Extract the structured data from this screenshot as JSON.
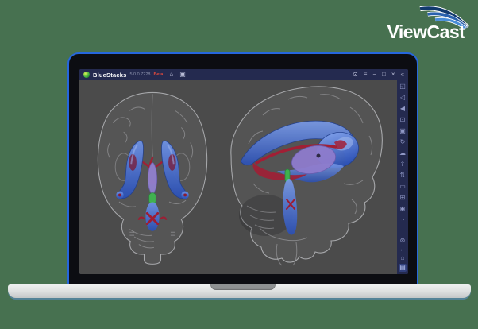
{
  "brand": {
    "name": "ViewCast",
    "registered": "®"
  },
  "emulator": {
    "titlebar": {
      "app_name": "BlueStacks",
      "version": "5.0.0.7228",
      "badge": "Beta",
      "left_icons": [
        {
          "name": "home-icon",
          "glyph": "⌂"
        },
        {
          "name": "screenshot-icon",
          "glyph": "▣"
        }
      ],
      "window_controls": [
        {
          "name": "info-icon",
          "glyph": "⊙"
        },
        {
          "name": "menu-icon",
          "glyph": "≡"
        },
        {
          "name": "minimize-icon",
          "glyph": "−"
        },
        {
          "name": "maximize-icon",
          "glyph": "□"
        },
        {
          "name": "close-icon",
          "glyph": "×"
        },
        {
          "name": "collapse-sidebar-icon",
          "glyph": "«"
        }
      ]
    },
    "sidebar": {
      "top_icons": [
        {
          "name": "fullscreen-icon",
          "glyph": "◱"
        },
        {
          "name": "volume-up-icon",
          "glyph": "◁"
        },
        {
          "name": "volume-down-icon",
          "glyph": "◀"
        },
        {
          "name": "screenshot-icon",
          "glyph": "⊡"
        },
        {
          "name": "camera-icon",
          "glyph": "▣"
        },
        {
          "name": "rotate-icon",
          "glyph": "↻"
        },
        {
          "name": "cloud-sync-icon",
          "glyph": "☁"
        },
        {
          "name": "install-apk-icon",
          "glyph": "⇪"
        },
        {
          "name": "shake-icon",
          "glyph": "⇅"
        },
        {
          "name": "folder-icon",
          "glyph": "▭"
        },
        {
          "name": "multi-instance-icon",
          "glyph": "⊞"
        },
        {
          "name": "macro-recorder-icon",
          "glyph": "◉"
        },
        {
          "name": "history-icon",
          "glyph": "◔"
        }
      ],
      "bottom_icons": [
        {
          "name": "settings-icon",
          "glyph": "⊛"
        },
        {
          "name": "back-icon",
          "glyph": "←"
        },
        {
          "name": "home-icon",
          "glyph": "⌂"
        },
        {
          "name": "recent-apps-icon",
          "glyph": "▤"
        }
      ]
    },
    "colors": {
      "background_green": "#477150",
      "titlebar_navy": "#242a4f",
      "viewport_gray": "#4b4b4b",
      "ventricle_blue": "#3c68cf",
      "fornix_red": "#a11f35",
      "thalamus_purple": "#8e7ccd",
      "aqueduct_green": "#3fb14d",
      "beta_badge_red": "#e0493d",
      "brand_blue": "#2a62ae",
      "screen_rim_blue": "#2667dd"
    }
  }
}
